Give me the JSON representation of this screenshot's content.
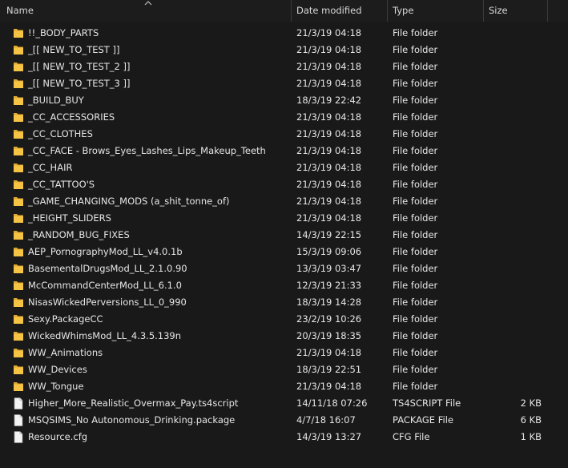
{
  "columns": {
    "name": "Name",
    "date": "Date modified",
    "type": "Type",
    "size": "Size"
  },
  "folder_color": "#f6c445",
  "file_color": "#f3f3f3",
  "rows": [
    {
      "name": "!!_BODY_PARTS",
      "date": "21/3/19 04:18",
      "type": "File folder",
      "size": "",
      "icon": "folder-icon"
    },
    {
      "name": "_[[ NEW_TO_TEST ]]",
      "date": "21/3/19 04:18",
      "type": "File folder",
      "size": "",
      "icon": "folder-icon"
    },
    {
      "name": "_[[ NEW_TO_TEST_2 ]]",
      "date": "21/3/19 04:18",
      "type": "File folder",
      "size": "",
      "icon": "folder-icon"
    },
    {
      "name": "_[[ NEW_TO_TEST_3 ]]",
      "date": "21/3/19 04:18",
      "type": "File folder",
      "size": "",
      "icon": "folder-icon"
    },
    {
      "name": "_BUILD_BUY",
      "date": "18/3/19 22:42",
      "type": "File folder",
      "size": "",
      "icon": "folder-icon"
    },
    {
      "name": "_CC_ACCESSORIES",
      "date": "21/3/19 04:18",
      "type": "File folder",
      "size": "",
      "icon": "folder-icon"
    },
    {
      "name": "_CC_CLOTHES",
      "date": "21/3/19 04:18",
      "type": "File folder",
      "size": "",
      "icon": "folder-icon"
    },
    {
      "name": "_CC_FACE - Brows_Eyes_Lashes_Lips_Makeup_Teeth",
      "date": "21/3/19 04:18",
      "type": "File folder",
      "size": "",
      "icon": "folder-icon"
    },
    {
      "name": "_CC_HAIR",
      "date": "21/3/19 04:18",
      "type": "File folder",
      "size": "",
      "icon": "folder-icon"
    },
    {
      "name": "_CC_TATTOO'S",
      "date": "21/3/19 04:18",
      "type": "File folder",
      "size": "",
      "icon": "folder-icon"
    },
    {
      "name": "_GAME_CHANGING_MODS (a_shit_tonne_of)",
      "date": "21/3/19 04:18",
      "type": "File folder",
      "size": "",
      "icon": "folder-icon"
    },
    {
      "name": "_HEIGHT_SLIDERS",
      "date": "21/3/19 04:18",
      "type": "File folder",
      "size": "",
      "icon": "folder-icon"
    },
    {
      "name": "_RANDOM_BUG_FIXES",
      "date": "14/3/19 22:15",
      "type": "File folder",
      "size": "",
      "icon": "folder-icon"
    },
    {
      "name": "AEP_PornographyMod_LL_v4.0.1b",
      "date": "15/3/19 09:06",
      "type": "File folder",
      "size": "",
      "icon": "folder-icon"
    },
    {
      "name": "BasementalDrugsMod_LL_2.1.0.90",
      "date": "13/3/19 03:47",
      "type": "File folder",
      "size": "",
      "icon": "folder-icon"
    },
    {
      "name": "McCommandCenterMod_LL_6.1.0",
      "date": "12/3/19 21:33",
      "type": "File folder",
      "size": "",
      "icon": "folder-icon"
    },
    {
      "name": "NisasWickedPerversions_LL_0_990",
      "date": "18/3/19 14:28",
      "type": "File folder",
      "size": "",
      "icon": "folder-icon"
    },
    {
      "name": "Sexy.PackageCC",
      "date": "23/2/19 10:26",
      "type": "File folder",
      "size": "",
      "icon": "folder-icon"
    },
    {
      "name": "WickedWhimsMod_LL_4.3.5.139n",
      "date": "20/3/19 18:35",
      "type": "File folder",
      "size": "",
      "icon": "folder-icon"
    },
    {
      "name": "WW_Animations",
      "date": "21/3/19 04:18",
      "type": "File folder",
      "size": "",
      "icon": "folder-icon"
    },
    {
      "name": "WW_Devices",
      "date": "18/3/19 22:51",
      "type": "File folder",
      "size": "",
      "icon": "folder-icon"
    },
    {
      "name": "WW_Tongue",
      "date": "21/3/19 04:18",
      "type": "File folder",
      "size": "",
      "icon": "folder-icon"
    },
    {
      "name": "Higher_More_Realistic_Overmax_Pay.ts4script",
      "date": "14/11/18 07:26",
      "type": "TS4SCRIPT File",
      "size": "2 KB",
      "icon": "file-icon"
    },
    {
      "name": "MSQSIMS_No Autonomous_Drinking.package",
      "date": "4/7/18 16:07",
      "type": "PACKAGE File",
      "size": "6 KB",
      "icon": "file-icon"
    },
    {
      "name": "Resource.cfg",
      "date": "14/3/19 13:27",
      "type": "CFG File",
      "size": "1 KB",
      "icon": "file-icon"
    }
  ]
}
